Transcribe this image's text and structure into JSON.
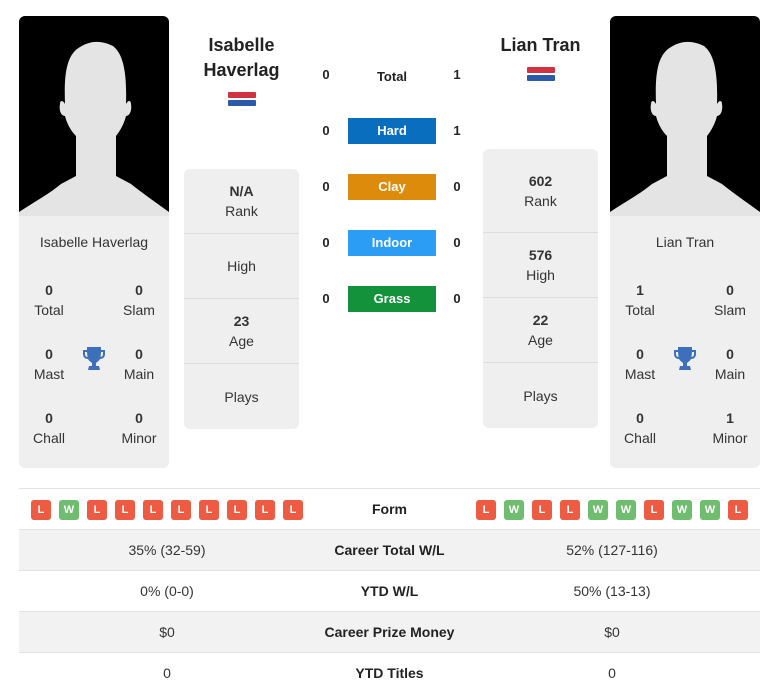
{
  "colors": {
    "hard": "#0a6ebf",
    "clay": "#dd8b0a",
    "indoor": "#2b9df4",
    "grass": "#13923b",
    "win": "#6fbe6f",
    "loss": "#ec5b42",
    "trophy": "#3d6fba"
  },
  "player_left": {
    "name_header": [
      "Isabelle",
      "Haverlag"
    ],
    "card_name": "Isabelle Haverlag",
    "flag": "netherlands-flag",
    "titles": {
      "total": {
        "value": "0",
        "label": "Total"
      },
      "slam": {
        "value": "0",
        "label": "Slam"
      },
      "mast": {
        "value": "0",
        "label": "Mast"
      },
      "main": {
        "value": "0",
        "label": "Main"
      },
      "chall": {
        "value": "0",
        "label": "Chall"
      },
      "minor": {
        "value": "0",
        "label": "Minor"
      }
    },
    "stats": {
      "rank": {
        "value": "N/A",
        "label": "Rank"
      },
      "high": {
        "value": "",
        "label": "High"
      },
      "age": {
        "value": "23",
        "label": "Age"
      },
      "plays": {
        "value": "",
        "label": "Plays"
      }
    }
  },
  "player_right": {
    "name_header": [
      "Lian Tran"
    ],
    "card_name": "Lian Tran",
    "flag": "netherlands-flag",
    "titles": {
      "total": {
        "value": "1",
        "label": "Total"
      },
      "slam": {
        "value": "0",
        "label": "Slam"
      },
      "mast": {
        "value": "0",
        "label": "Mast"
      },
      "main": {
        "value": "0",
        "label": "Main"
      },
      "chall": {
        "value": "0",
        "label": "Chall"
      },
      "minor": {
        "value": "1",
        "label": "Minor"
      }
    },
    "stats": {
      "rank": {
        "value": "602",
        "label": "Rank"
      },
      "high": {
        "value": "576",
        "label": "High"
      },
      "age": {
        "value": "22",
        "label": "Age"
      },
      "plays": {
        "value": "",
        "label": "Plays"
      }
    }
  },
  "h2h": [
    {
      "label": "Total",
      "left": "0",
      "right": "1",
      "surface": "total"
    },
    {
      "label": "Hard",
      "left": "0",
      "right": "1",
      "surface": "hard"
    },
    {
      "label": "Clay",
      "left": "0",
      "right": "0",
      "surface": "clay"
    },
    {
      "label": "Indoor",
      "left": "0",
      "right": "0",
      "surface": "indoor"
    },
    {
      "label": "Grass",
      "left": "0",
      "right": "0",
      "surface": "grass"
    }
  ],
  "comparison": {
    "form_label": "Form",
    "left_form": [
      "L",
      "W",
      "L",
      "L",
      "L",
      "L",
      "L",
      "L",
      "L",
      "L"
    ],
    "right_form": [
      "L",
      "W",
      "L",
      "L",
      "W",
      "W",
      "L",
      "W",
      "W",
      "L"
    ],
    "rows": [
      {
        "label": "Career Total W/L",
        "left": "35% (32-59)",
        "right": "52% (127-116)"
      },
      {
        "label": "YTD W/L",
        "left": "0% (0-0)",
        "right": "50% (13-13)"
      },
      {
        "label": "Career Prize Money",
        "left": "$0",
        "right": "$0"
      },
      {
        "label": "YTD Titles",
        "left": "0",
        "right": "0"
      }
    ]
  }
}
